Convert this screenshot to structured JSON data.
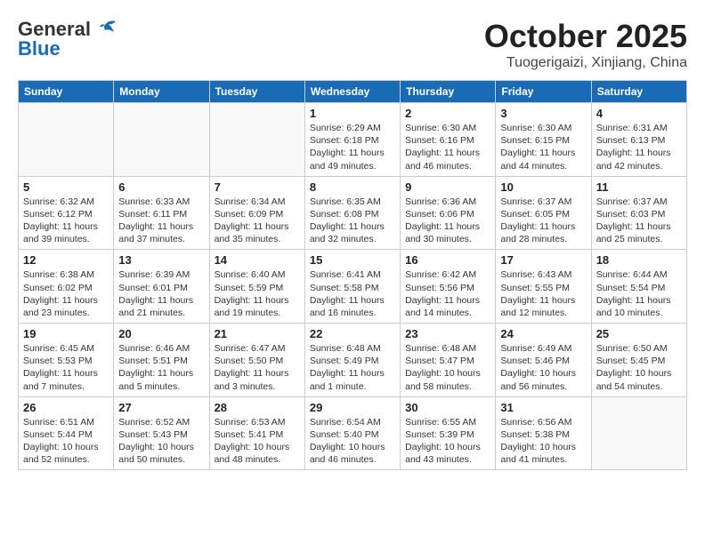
{
  "header": {
    "logo_general": "General",
    "logo_blue": "Blue",
    "month": "October 2025",
    "location": "Tuogerigaizi, Xinjiang, China"
  },
  "weekdays": [
    "Sunday",
    "Monday",
    "Tuesday",
    "Wednesday",
    "Thursday",
    "Friday",
    "Saturday"
  ],
  "weeks": [
    [
      {
        "day": "",
        "info": ""
      },
      {
        "day": "",
        "info": ""
      },
      {
        "day": "",
        "info": ""
      },
      {
        "day": "1",
        "info": "Sunrise: 6:29 AM\nSunset: 6:18 PM\nDaylight: 11 hours\nand 49 minutes."
      },
      {
        "day": "2",
        "info": "Sunrise: 6:30 AM\nSunset: 6:16 PM\nDaylight: 11 hours\nand 46 minutes."
      },
      {
        "day": "3",
        "info": "Sunrise: 6:30 AM\nSunset: 6:15 PM\nDaylight: 11 hours\nand 44 minutes."
      },
      {
        "day": "4",
        "info": "Sunrise: 6:31 AM\nSunset: 6:13 PM\nDaylight: 11 hours\nand 42 minutes."
      }
    ],
    [
      {
        "day": "5",
        "info": "Sunrise: 6:32 AM\nSunset: 6:12 PM\nDaylight: 11 hours\nand 39 minutes."
      },
      {
        "day": "6",
        "info": "Sunrise: 6:33 AM\nSunset: 6:11 PM\nDaylight: 11 hours\nand 37 minutes."
      },
      {
        "day": "7",
        "info": "Sunrise: 6:34 AM\nSunset: 6:09 PM\nDaylight: 11 hours\nand 35 minutes."
      },
      {
        "day": "8",
        "info": "Sunrise: 6:35 AM\nSunset: 6:08 PM\nDaylight: 11 hours\nand 32 minutes."
      },
      {
        "day": "9",
        "info": "Sunrise: 6:36 AM\nSunset: 6:06 PM\nDaylight: 11 hours\nand 30 minutes."
      },
      {
        "day": "10",
        "info": "Sunrise: 6:37 AM\nSunset: 6:05 PM\nDaylight: 11 hours\nand 28 minutes."
      },
      {
        "day": "11",
        "info": "Sunrise: 6:37 AM\nSunset: 6:03 PM\nDaylight: 11 hours\nand 25 minutes."
      }
    ],
    [
      {
        "day": "12",
        "info": "Sunrise: 6:38 AM\nSunset: 6:02 PM\nDaylight: 11 hours\nand 23 minutes."
      },
      {
        "day": "13",
        "info": "Sunrise: 6:39 AM\nSunset: 6:01 PM\nDaylight: 11 hours\nand 21 minutes."
      },
      {
        "day": "14",
        "info": "Sunrise: 6:40 AM\nSunset: 5:59 PM\nDaylight: 11 hours\nand 19 minutes."
      },
      {
        "day": "15",
        "info": "Sunrise: 6:41 AM\nSunset: 5:58 PM\nDaylight: 11 hours\nand 16 minutes."
      },
      {
        "day": "16",
        "info": "Sunrise: 6:42 AM\nSunset: 5:56 PM\nDaylight: 11 hours\nand 14 minutes."
      },
      {
        "day": "17",
        "info": "Sunrise: 6:43 AM\nSunset: 5:55 PM\nDaylight: 11 hours\nand 12 minutes."
      },
      {
        "day": "18",
        "info": "Sunrise: 6:44 AM\nSunset: 5:54 PM\nDaylight: 11 hours\nand 10 minutes."
      }
    ],
    [
      {
        "day": "19",
        "info": "Sunrise: 6:45 AM\nSunset: 5:53 PM\nDaylight: 11 hours\nand 7 minutes."
      },
      {
        "day": "20",
        "info": "Sunrise: 6:46 AM\nSunset: 5:51 PM\nDaylight: 11 hours\nand 5 minutes."
      },
      {
        "day": "21",
        "info": "Sunrise: 6:47 AM\nSunset: 5:50 PM\nDaylight: 11 hours\nand 3 minutes."
      },
      {
        "day": "22",
        "info": "Sunrise: 6:48 AM\nSunset: 5:49 PM\nDaylight: 11 hours\nand 1 minute."
      },
      {
        "day": "23",
        "info": "Sunrise: 6:48 AM\nSunset: 5:47 PM\nDaylight: 10 hours\nand 58 minutes."
      },
      {
        "day": "24",
        "info": "Sunrise: 6:49 AM\nSunset: 5:46 PM\nDaylight: 10 hours\nand 56 minutes."
      },
      {
        "day": "25",
        "info": "Sunrise: 6:50 AM\nSunset: 5:45 PM\nDaylight: 10 hours\nand 54 minutes."
      }
    ],
    [
      {
        "day": "26",
        "info": "Sunrise: 6:51 AM\nSunset: 5:44 PM\nDaylight: 10 hours\nand 52 minutes."
      },
      {
        "day": "27",
        "info": "Sunrise: 6:52 AM\nSunset: 5:43 PM\nDaylight: 10 hours\nand 50 minutes."
      },
      {
        "day": "28",
        "info": "Sunrise: 6:53 AM\nSunset: 5:41 PM\nDaylight: 10 hours\nand 48 minutes."
      },
      {
        "day": "29",
        "info": "Sunrise: 6:54 AM\nSunset: 5:40 PM\nDaylight: 10 hours\nand 46 minutes."
      },
      {
        "day": "30",
        "info": "Sunrise: 6:55 AM\nSunset: 5:39 PM\nDaylight: 10 hours\nand 43 minutes."
      },
      {
        "day": "31",
        "info": "Sunrise: 6:56 AM\nSunset: 5:38 PM\nDaylight: 10 hours\nand 41 minutes."
      },
      {
        "day": "",
        "info": ""
      }
    ]
  ]
}
